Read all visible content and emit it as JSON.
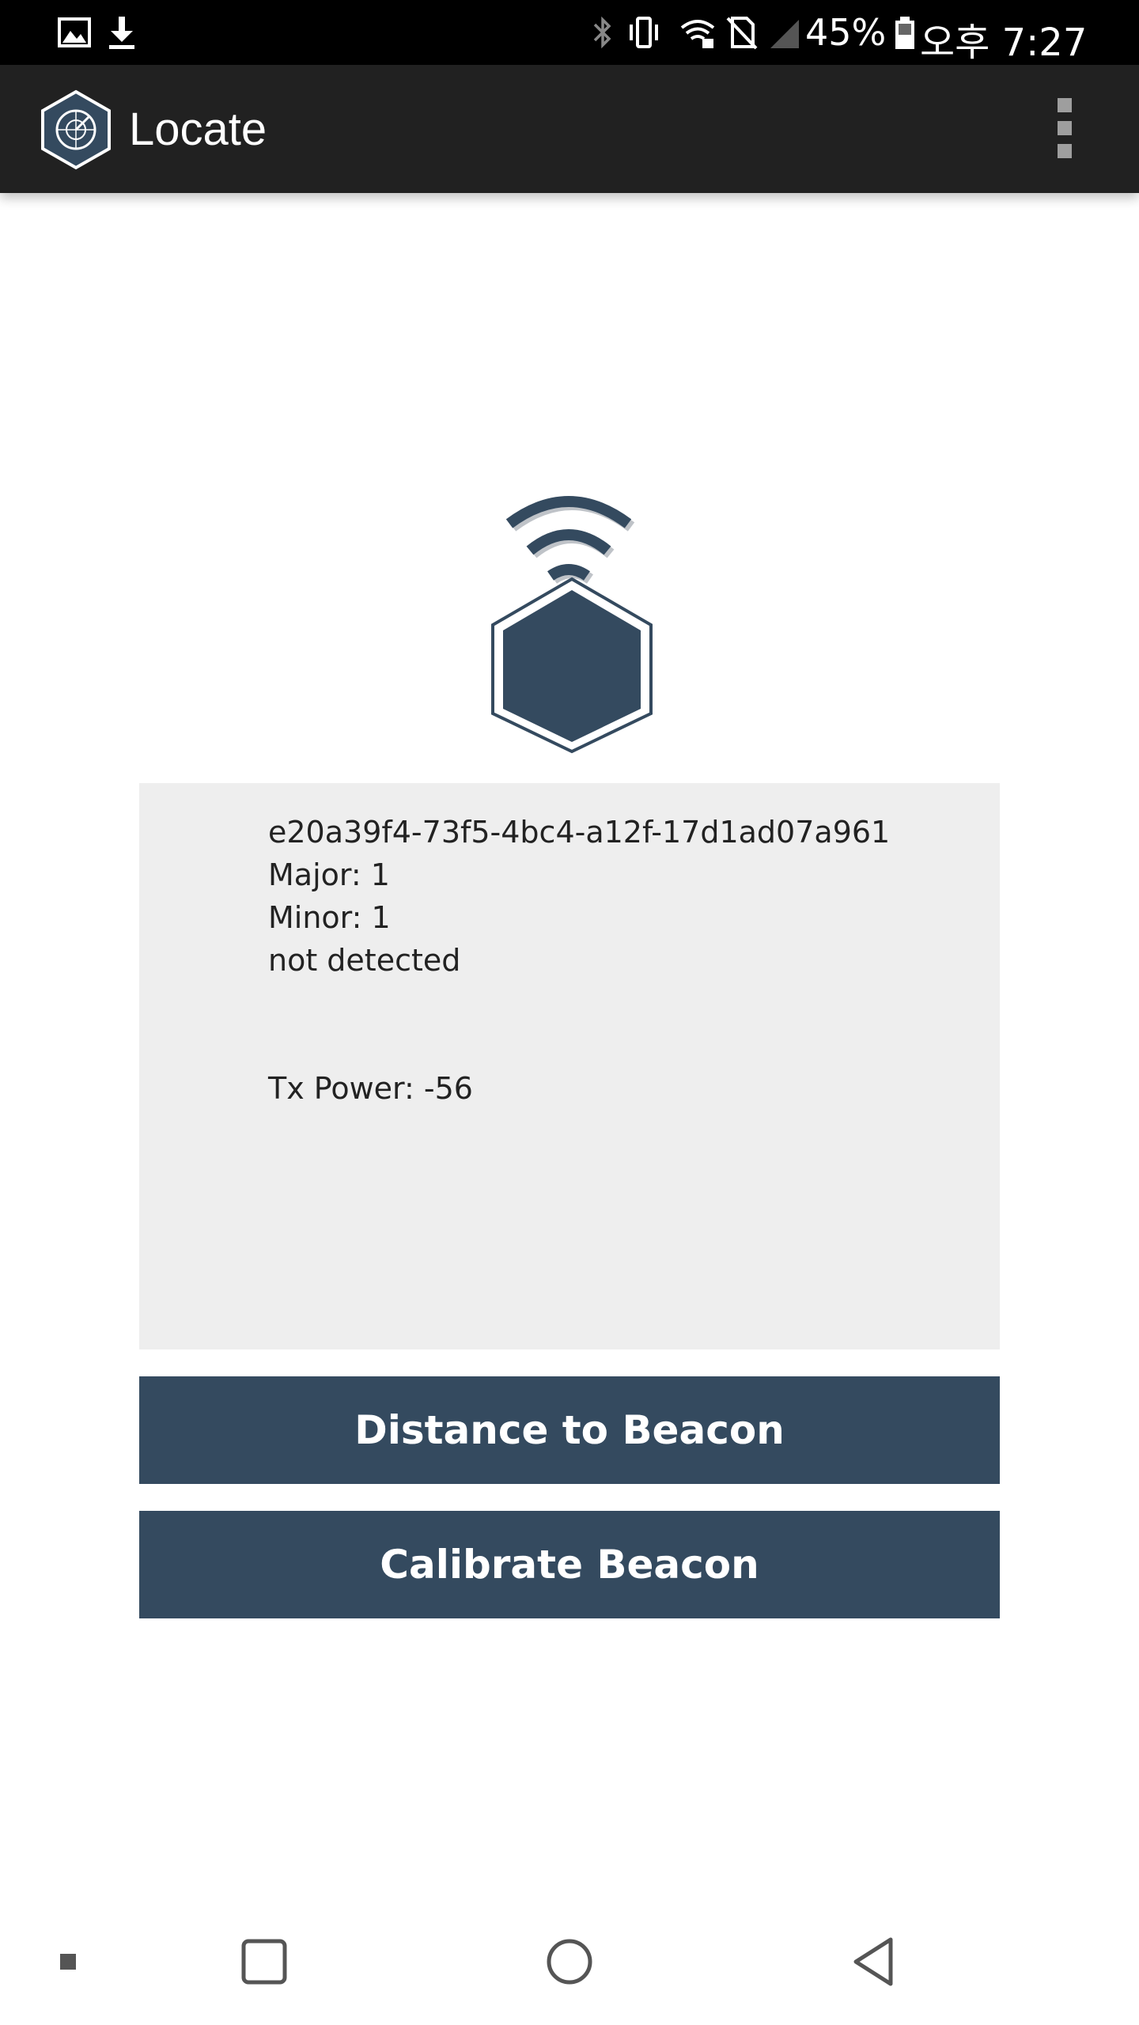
{
  "status_bar": {
    "battery_percent": "45%",
    "time": "오후 7:27",
    "icons": [
      "image-icon",
      "download-icon",
      "bluetooth-icon",
      "vibrate-icon",
      "wifi-lock-icon",
      "no-sim-icon",
      "signal-icon",
      "battery-icon"
    ]
  },
  "app_bar": {
    "title": "Locate",
    "logo_icon": "radar-hexagon-icon",
    "menu_icon": "overflow-menu-icon"
  },
  "beacon": {
    "icon": "beacon-signal-icon",
    "uuid": "e20a39f4-73f5-4bc4-a12f-17d1ad07a961",
    "major": "Major: 1",
    "minor": "Minor: 1",
    "status": "not detected",
    "tx_power": "Tx Power: -56"
  },
  "actions": {
    "distance_label": "Distance to Beacon",
    "calibrate_label": "Calibrate Beacon"
  },
  "nav_bar": {
    "items": [
      "dot-icon",
      "recents-icon",
      "home-icon",
      "back-icon"
    ]
  },
  "colors": {
    "primary": "#344a5f",
    "app_bar": "#212121",
    "panel": "#eeeeee"
  }
}
